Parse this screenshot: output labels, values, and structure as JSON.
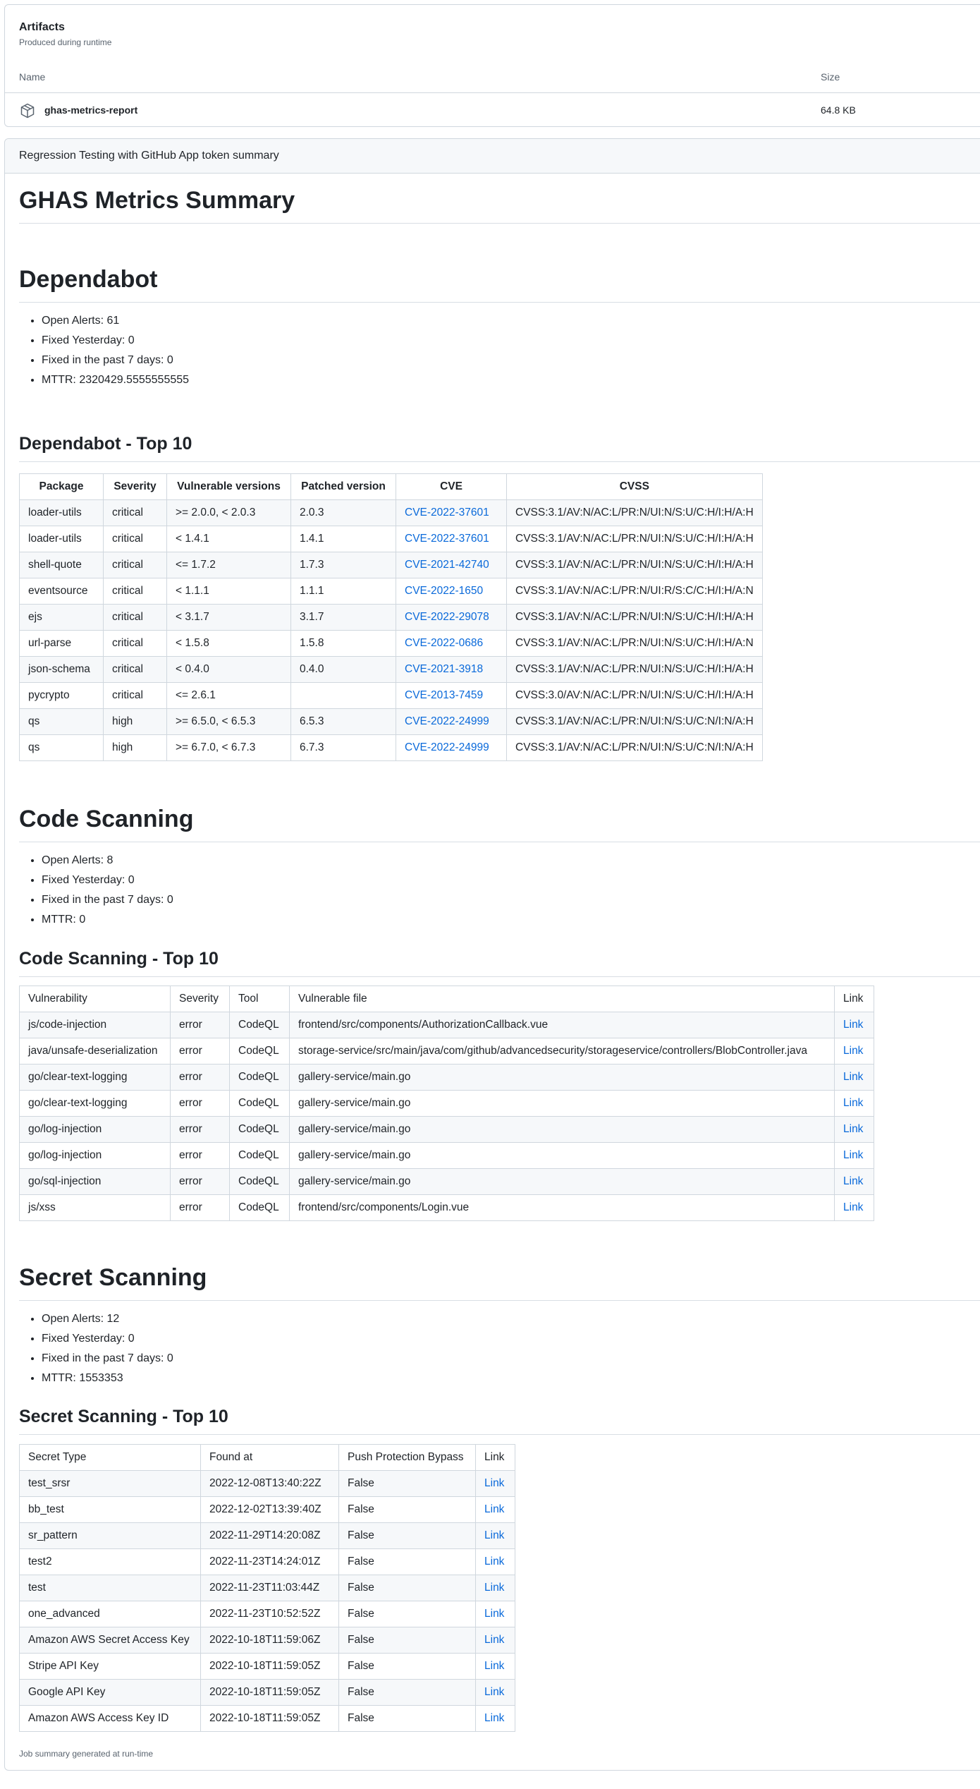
{
  "artifacts": {
    "title": "Artifacts",
    "subtitle": "Produced during runtime",
    "col_name": "Name",
    "col_size": "Size",
    "items": [
      {
        "name": "ghas-metrics-report",
        "size": "64.8 KB",
        "icon": "package-icon"
      }
    ]
  },
  "summary": {
    "job_title": "Regression Testing with GitHub App token summary",
    "page_title": "GHAS Metrics Summary",
    "footer": "Job summary generated at run-time"
  },
  "dependabot": {
    "heading": "Dependabot",
    "stats": [
      "Open Alerts: 61",
      "Fixed Yesterday: 0",
      "Fixed in the past 7 days: 0",
      "MTTR: 2320429.5555555555"
    ],
    "top_heading": "Dependabot - Top 10",
    "columns": [
      "Package",
      "Severity",
      "Vulnerable versions",
      "Patched version",
      "CVE",
      "CVSS"
    ],
    "rows": [
      [
        "loader-utils",
        "critical",
        ">= 2.0.0, < 2.0.3",
        "2.0.3",
        "CVE-2022-37601",
        "CVSS:3.1/AV:N/AC:L/PR:N/UI:N/S:U/C:H/I:H/A:H"
      ],
      [
        "loader-utils",
        "critical",
        "< 1.4.1",
        "1.4.1",
        "CVE-2022-37601",
        "CVSS:3.1/AV:N/AC:L/PR:N/UI:N/S:U/C:H/I:H/A:H"
      ],
      [
        "shell-quote",
        "critical",
        "<= 1.7.2",
        "1.7.3",
        "CVE-2021-42740",
        "CVSS:3.1/AV:N/AC:L/PR:N/UI:N/S:U/C:H/I:H/A:H"
      ],
      [
        "eventsource",
        "critical",
        "< 1.1.1",
        "1.1.1",
        "CVE-2022-1650",
        "CVSS:3.1/AV:N/AC:L/PR:N/UI:R/S:C/C:H/I:H/A:N"
      ],
      [
        "ejs",
        "critical",
        "< 3.1.7",
        "3.1.7",
        "CVE-2022-29078",
        "CVSS:3.1/AV:N/AC:L/PR:N/UI:N/S:U/C:H/I:H/A:H"
      ],
      [
        "url-parse",
        "critical",
        "< 1.5.8",
        "1.5.8",
        "CVE-2022-0686",
        "CVSS:3.1/AV:N/AC:L/PR:N/UI:N/S:U/C:H/I:H/A:N"
      ],
      [
        "json-schema",
        "critical",
        "< 0.4.0",
        "0.4.0",
        "CVE-2021-3918",
        "CVSS:3.1/AV:N/AC:L/PR:N/UI:N/S:U/C:H/I:H/A:H"
      ],
      [
        "pycrypto",
        "critical",
        "<= 2.6.1",
        "",
        "CVE-2013-7459",
        "CVSS:3.0/AV:N/AC:L/PR:N/UI:N/S:U/C:H/I:H/A:H"
      ],
      [
        "qs",
        "high",
        ">= 6.5.0, < 6.5.3",
        "6.5.3",
        "CVE-2022-24999",
        "CVSS:3.1/AV:N/AC:L/PR:N/UI:N/S:U/C:N/I:N/A:H"
      ],
      [
        "qs",
        "high",
        ">= 6.7.0, < 6.7.3",
        "6.7.3",
        "CVE-2022-24999",
        "CVSS:3.1/AV:N/AC:L/PR:N/UI:N/S:U/C:N/I:N/A:H"
      ]
    ]
  },
  "code_scanning": {
    "heading": "Code Scanning",
    "stats": [
      "Open Alerts: 8",
      "Fixed Yesterday: 0",
      "Fixed in the past 7 days: 0",
      "MTTR: 0"
    ],
    "top_heading": "Code Scanning - Top 10",
    "columns": [
      "Vulnerability",
      "Severity",
      "Tool",
      "Vulnerable file",
      "Link"
    ],
    "rows": [
      [
        "js/code-injection",
        "error",
        "CodeQL",
        "frontend/src/components/AuthorizationCallback.vue",
        "Link"
      ],
      [
        "java/unsafe-deserialization",
        "error",
        "CodeQL",
        "storage-service/src/main/java/com/github/advancedsecurity/storageservice/controllers/BlobController.java",
        "Link"
      ],
      [
        "go/clear-text-logging",
        "error",
        "CodeQL",
        "gallery-service/main.go",
        "Link"
      ],
      [
        "go/clear-text-logging",
        "error",
        "CodeQL",
        "gallery-service/main.go",
        "Link"
      ],
      [
        "go/log-injection",
        "error",
        "CodeQL",
        "gallery-service/main.go",
        "Link"
      ],
      [
        "go/log-injection",
        "error",
        "CodeQL",
        "gallery-service/main.go",
        "Link"
      ],
      [
        "go/sql-injection",
        "error",
        "CodeQL",
        "gallery-service/main.go",
        "Link"
      ],
      [
        "js/xss",
        "error",
        "CodeQL",
        "frontend/src/components/Login.vue",
        "Link"
      ]
    ]
  },
  "secret_scanning": {
    "heading": "Secret Scanning",
    "stats": [
      "Open Alerts: 12",
      "Fixed Yesterday: 0",
      "Fixed in the past 7 days: 0",
      "MTTR: 1553353"
    ],
    "top_heading": "Secret Scanning - Top 10",
    "columns": [
      "Secret Type",
      "Found at",
      "Push Protection Bypass",
      "Link"
    ],
    "rows": [
      [
        "test_srsr",
        "2022-12-08T13:40:22Z",
        "False",
        "Link"
      ],
      [
        "bb_test",
        "2022-12-02T13:39:40Z",
        "False",
        "Link"
      ],
      [
        "sr_pattern",
        "2022-11-29T14:20:08Z",
        "False",
        "Link"
      ],
      [
        "test2",
        "2022-11-23T14:24:01Z",
        "False",
        "Link"
      ],
      [
        "test",
        "2022-11-23T11:03:44Z",
        "False",
        "Link"
      ],
      [
        "one_advanced",
        "2022-11-23T10:52:52Z",
        "False",
        "Link"
      ],
      [
        "Amazon AWS Secret Access Key",
        "2022-10-18T11:59:06Z",
        "False",
        "Link"
      ],
      [
        "Stripe API Key",
        "2022-10-18T11:59:05Z",
        "False",
        "Link"
      ],
      [
        "Google API Key",
        "2022-10-18T11:59:05Z",
        "False",
        "Link"
      ],
      [
        "Amazon AWS Access Key ID",
        "2022-10-18T11:59:05Z",
        "False",
        "Link"
      ]
    ]
  },
  "colors": {
    "link": "#0969da",
    "border": "#d0d7de",
    "muted": "#59636e",
    "stripe": "#f6f8fa"
  }
}
